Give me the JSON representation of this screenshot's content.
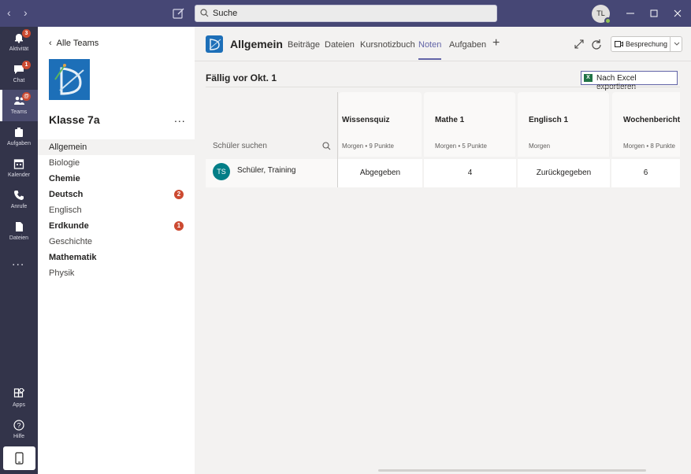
{
  "titlebar": {
    "search_placeholder": "Suche",
    "user_initials": "TL"
  },
  "rail": {
    "items": [
      {
        "label": "Aktivität",
        "icon": "bell-icon",
        "badge": "3"
      },
      {
        "label": "Chat",
        "icon": "chat-icon",
        "badge": "1"
      },
      {
        "label": "Teams",
        "icon": "teams-icon",
        "badge": "@",
        "active": true
      },
      {
        "label": "Aufgaben",
        "icon": "assignments-icon"
      },
      {
        "label": "Kalender",
        "icon": "calendar-icon"
      },
      {
        "label": "Anrufe",
        "icon": "phone-icon"
      },
      {
        "label": "Dateien",
        "icon": "files-icon"
      }
    ],
    "more": "...",
    "apps_label": "Apps",
    "help_label": "Hilfe"
  },
  "team": {
    "back_label": "Alle Teams",
    "name": "Klasse 7a",
    "more": "...",
    "channels": [
      {
        "name": "Allgemein",
        "active": true
      },
      {
        "name": "Biologie"
      },
      {
        "name": "Chemie",
        "bold": true
      },
      {
        "name": "Deutsch",
        "bold": true,
        "badge": "2"
      },
      {
        "name": "Englisch"
      },
      {
        "name": "Erdkunde",
        "bold": true,
        "badge": "1"
      },
      {
        "name": "Geschichte"
      },
      {
        "name": "Mathematik",
        "bold": true
      },
      {
        "name": "Physik"
      }
    ]
  },
  "header": {
    "channel_title": "Allgemein",
    "tabs": [
      "Beiträge",
      "Dateien",
      "Kursnotizbuch",
      "Noten",
      "Aufgaben"
    ],
    "active_tab": "Noten",
    "meeting_label": "Besprechung"
  },
  "grades": {
    "due_title": "Fällig vor Okt. 1",
    "export_label": "Nach Excel exportieren",
    "student_search_placeholder": "Schüler suchen",
    "columns": [
      {
        "name": "Wissensquiz",
        "meta": "Morgen • 9 Punkte"
      },
      {
        "name": "Mathe 1",
        "meta": "Morgen • 5 Punkte"
      },
      {
        "name": "Englisch 1",
        "meta": "Morgen"
      },
      {
        "name": "Wochenbericht",
        "meta": "Morgen • 8 Punkte"
      }
    ],
    "students": [
      {
        "initials": "TS",
        "name": "Schüler, Training",
        "cells": [
          "Abgegeben",
          "4",
          "Zurückgegeben",
          "6"
        ]
      }
    ]
  },
  "colors": {
    "titlebar": "#464775",
    "rail": "#33344a",
    "accent": "#6264a7",
    "badge": "#cc4a31",
    "student_avatar": "#037e87"
  }
}
